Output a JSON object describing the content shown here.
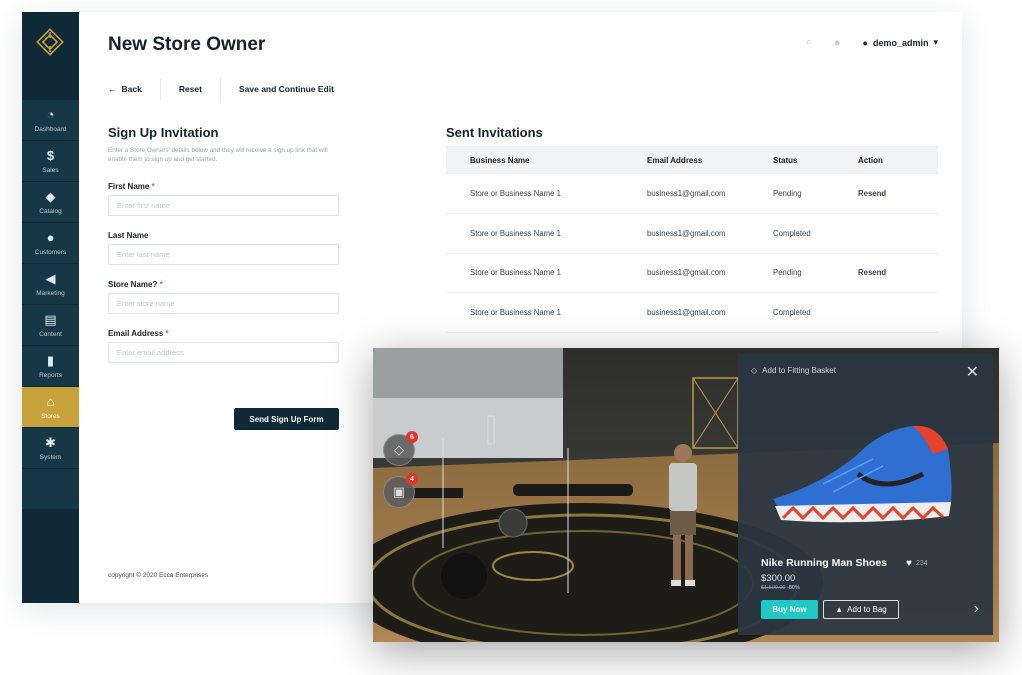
{
  "sidebar": {
    "items": [
      {
        "label": "Dashboard",
        "icon": "gauge-icon"
      },
      {
        "label": "Sales",
        "icon": "dollar-icon"
      },
      {
        "label": "Catalog",
        "icon": "box-icon"
      },
      {
        "label": "Customers",
        "icon": "person-icon"
      },
      {
        "label": "Marketing",
        "icon": "megaphone-icon"
      },
      {
        "label": "Content",
        "icon": "layout-icon"
      },
      {
        "label": "Reports",
        "icon": "bar-chart-icon"
      },
      {
        "label": "Stores",
        "icon": "store-icon",
        "active": true
      },
      {
        "label": "System",
        "icon": "gear-icon"
      }
    ],
    "colors": {
      "bg": "#0f2a36",
      "item": "#163846",
      "active": "#c7a23a"
    }
  },
  "header": {
    "title": "New Store Owner",
    "user": "demo_admin"
  },
  "toolbar": {
    "back_label": "Back",
    "reset_label": "Reset",
    "save_label": "Save and Continue Edit"
  },
  "signup": {
    "title": "Sign Up Invitation",
    "description": "Enter a Store Owners' details below and they will receive a sign up link that will enable them to sign up and get started.",
    "fields": [
      {
        "label": "First Name",
        "required": "*",
        "placeholder": "Enter first name"
      },
      {
        "label": "Last Name",
        "required": "",
        "placeholder": "Enter last name"
      },
      {
        "label": "Store Name?",
        "required": "*",
        "placeholder": "Enter store name"
      },
      {
        "label": "Email Address",
        "required": "*",
        "placeholder": "Enter email address"
      }
    ],
    "submit_label": "Send Sign Up Form"
  },
  "invitations": {
    "title": "Sent Invitations",
    "columns": [
      "Business Name",
      "Email Address",
      "Status",
      "Action"
    ],
    "rows": [
      {
        "business": "Store or Business Name 1",
        "email": "business1@gmail.com",
        "status": "Pending",
        "action": "Resend"
      },
      {
        "business": "Store or Business Name 1",
        "email": "business1@gmail.com",
        "status": "Completed",
        "action": ""
      },
      {
        "business": "Store or Business Name 1",
        "email": "business1@gmail.com",
        "status": "Pending",
        "action": "Resend"
      },
      {
        "business": "Store or Business Name 1",
        "email": "business1@gmail.com",
        "status": "Completed",
        "action": ""
      }
    ]
  },
  "footer": {
    "copyright": "copyright © 2020 Ecca Enterprises"
  },
  "store3d": {
    "basket_count": "6",
    "bag_count": "4",
    "product": {
      "header": "Add to Fitting Basket",
      "name": "Nike Running Man Shoes",
      "likes": "234",
      "price": "$300.00",
      "old_price": "$1,500.00",
      "discount": "-80%",
      "buy_label": "Buy Now",
      "bag_label": "Add to Bag"
    },
    "colors": {
      "accent": "#1fc7c5",
      "badge": "#e3352b"
    }
  }
}
